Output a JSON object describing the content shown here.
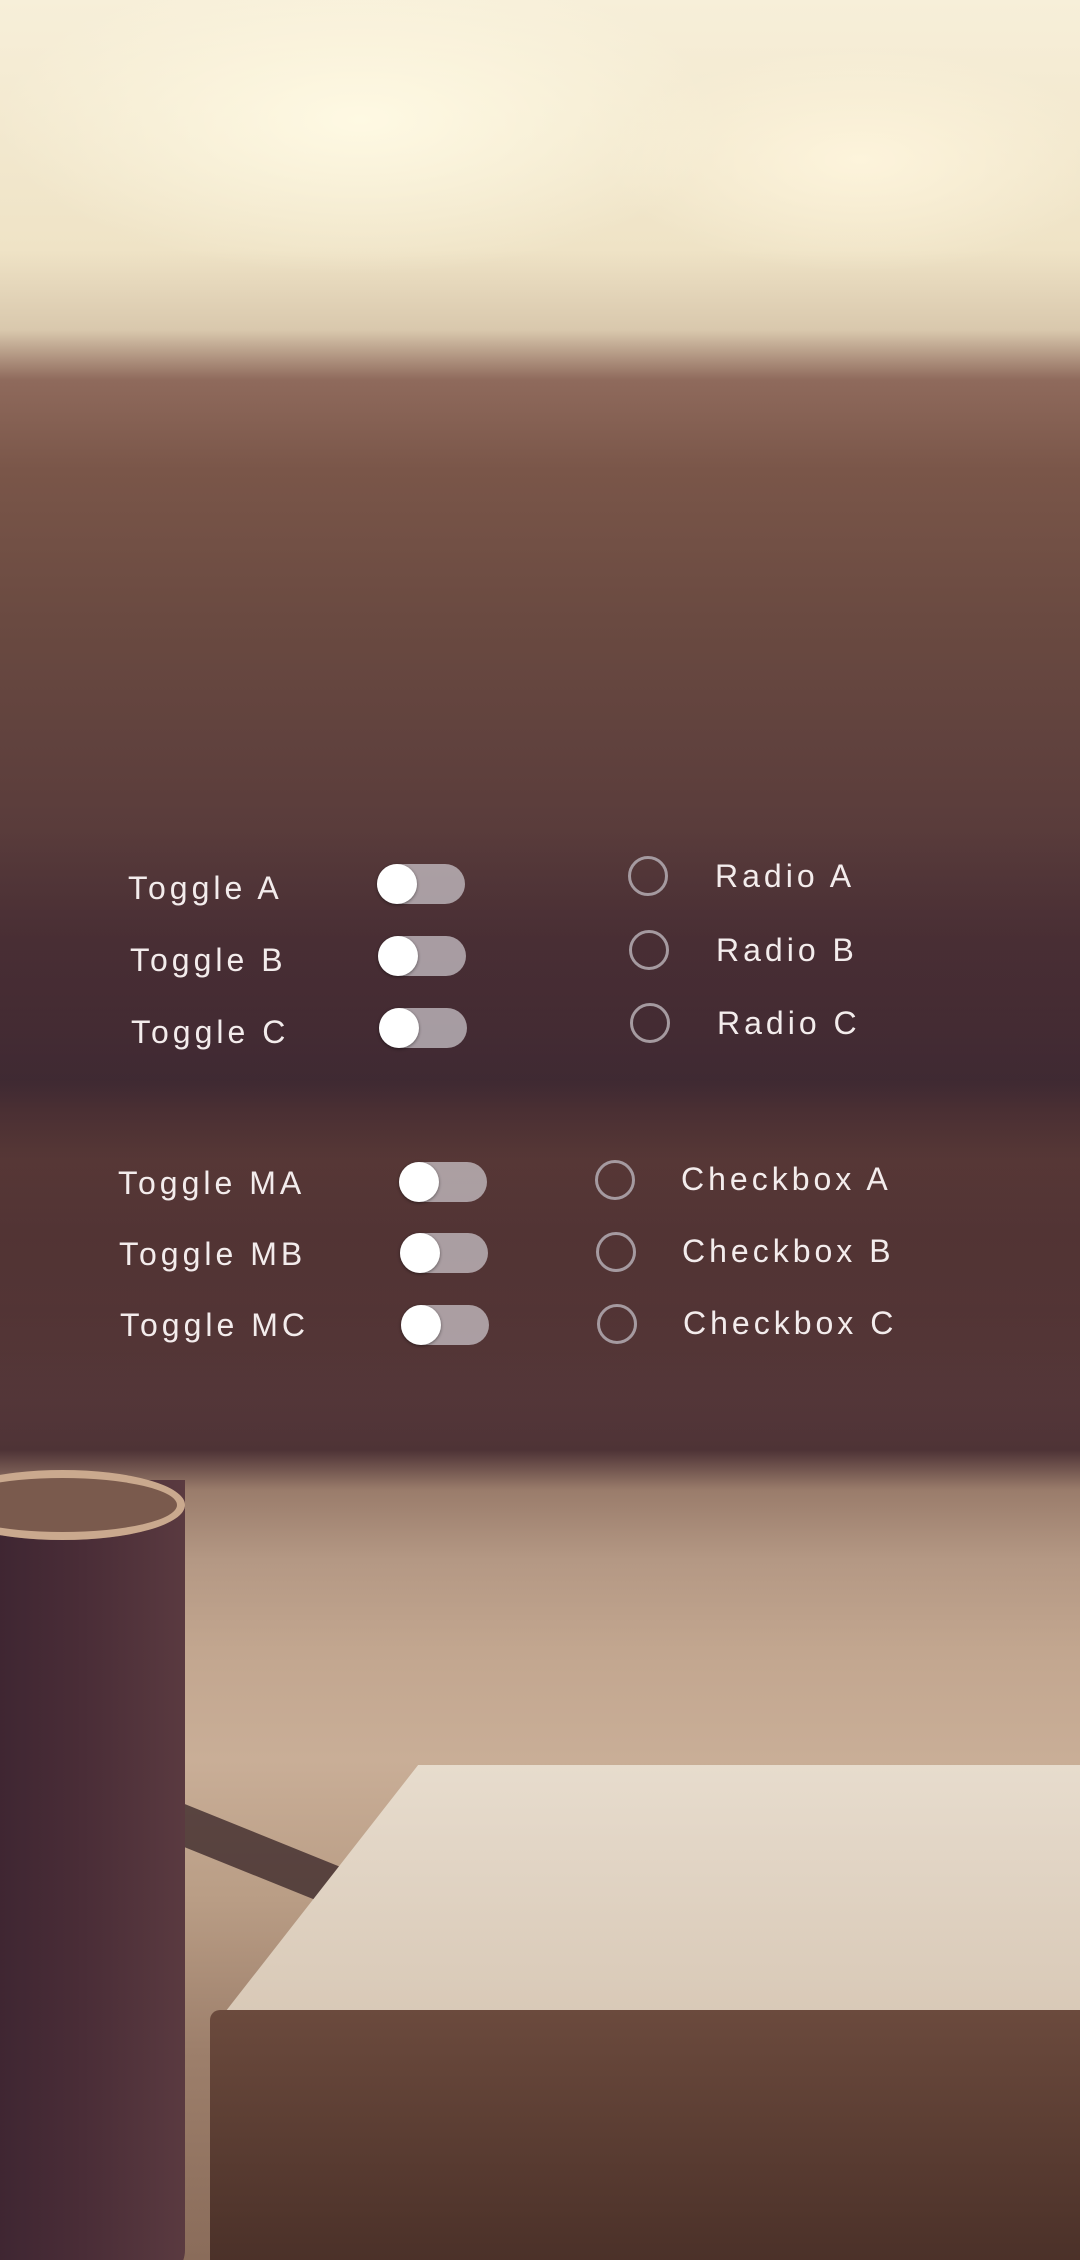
{
  "toggles_group_1": [
    {
      "label": "Toggle A",
      "on": false
    },
    {
      "label": "Toggle B",
      "on": false
    },
    {
      "label": "Toggle C",
      "on": false
    }
  ],
  "radios": [
    {
      "label": "Radio A",
      "selected": false
    },
    {
      "label": "Radio B",
      "selected": false
    },
    {
      "label": "Radio C",
      "selected": false
    }
  ],
  "toggles_group_2": [
    {
      "label": "Toggle MA",
      "on": false
    },
    {
      "label": "Toggle MB",
      "on": false
    },
    {
      "label": "Toggle MC",
      "on": false
    }
  ],
  "checkboxes": [
    {
      "label": "Checkbox A",
      "checked": false
    },
    {
      "label": "Checkbox B",
      "checked": false
    },
    {
      "label": "Checkbox C",
      "checked": false
    }
  ],
  "colors": {
    "label_text": "#f3ecec",
    "toggle_track": "#cdc8cd",
    "toggle_knob": "#ffffff",
    "circle_outline": "#a59aa0"
  }
}
